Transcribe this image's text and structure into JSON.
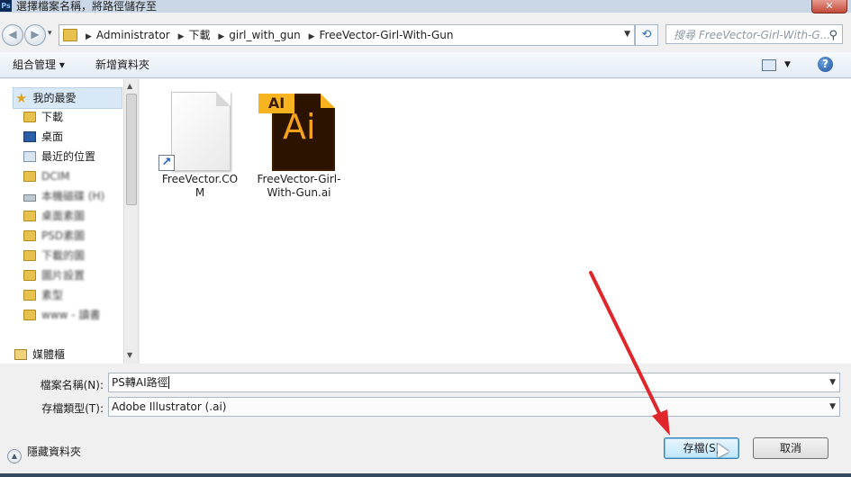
{
  "title": {
    "app_icon": "Ps",
    "text": "選擇檔案名稱，將路徑儲存至",
    "close_icon": "close-icon"
  },
  "address": {
    "crumbs": [
      "Administrator",
      "下載",
      "girl_with_gun",
      "FreeVector-Girl-With-Gun"
    ],
    "search_placeholder": "搜尋 FreeVector-Girl-With-G..."
  },
  "toolbar": {
    "organize": "組合管理 ▾",
    "new_folder": "新增資料夾"
  },
  "navpane": {
    "favorites": "我的最愛",
    "items": [
      {
        "label": "下載",
        "icon": "downloads-folder-icon"
      },
      {
        "label": "桌面",
        "icon": "desktop-icon"
      },
      {
        "label": "最近的位置",
        "icon": "recent-places-icon"
      },
      {
        "label": "DCIM",
        "icon": "folder-icon"
      },
      {
        "label": "本機磁碟 (H)",
        "icon": "drive-icon"
      },
      {
        "label": "桌面素圖",
        "icon": "folder-icon"
      },
      {
        "label": "PSD素圖",
        "icon": "folder-icon"
      },
      {
        "label": "下載的圖",
        "icon": "folder-icon"
      },
      {
        "label": "圖片設置",
        "icon": "folder-icon"
      },
      {
        "label": "素型",
        "icon": "folder-icon"
      },
      {
        "label": "www - 讀書",
        "icon": "folder-icon"
      }
    ],
    "libraries": "媒體櫃"
  },
  "files": [
    {
      "name": "FreeVector.COM",
      "icon": "internet-shortcut-icon"
    },
    {
      "name": "FreeVector-Girl-With-Gun.ai",
      "icon": "illustrator-file-icon"
    }
  ],
  "form": {
    "filename_label": "檔案名稱(N):",
    "filename_value": "PS轉AI路徑",
    "filetype_label": "存檔類型(T):",
    "filetype_value": "Adobe Illustrator (.ai)",
    "hide_folders": "隱藏資料夾",
    "save_button": "存檔(S)",
    "cancel_button": "取消"
  },
  "colors": {
    "annotation_arrow": "#e0262b",
    "ai_orange": "#f7a21b",
    "ai_dark": "#2b1300"
  }
}
